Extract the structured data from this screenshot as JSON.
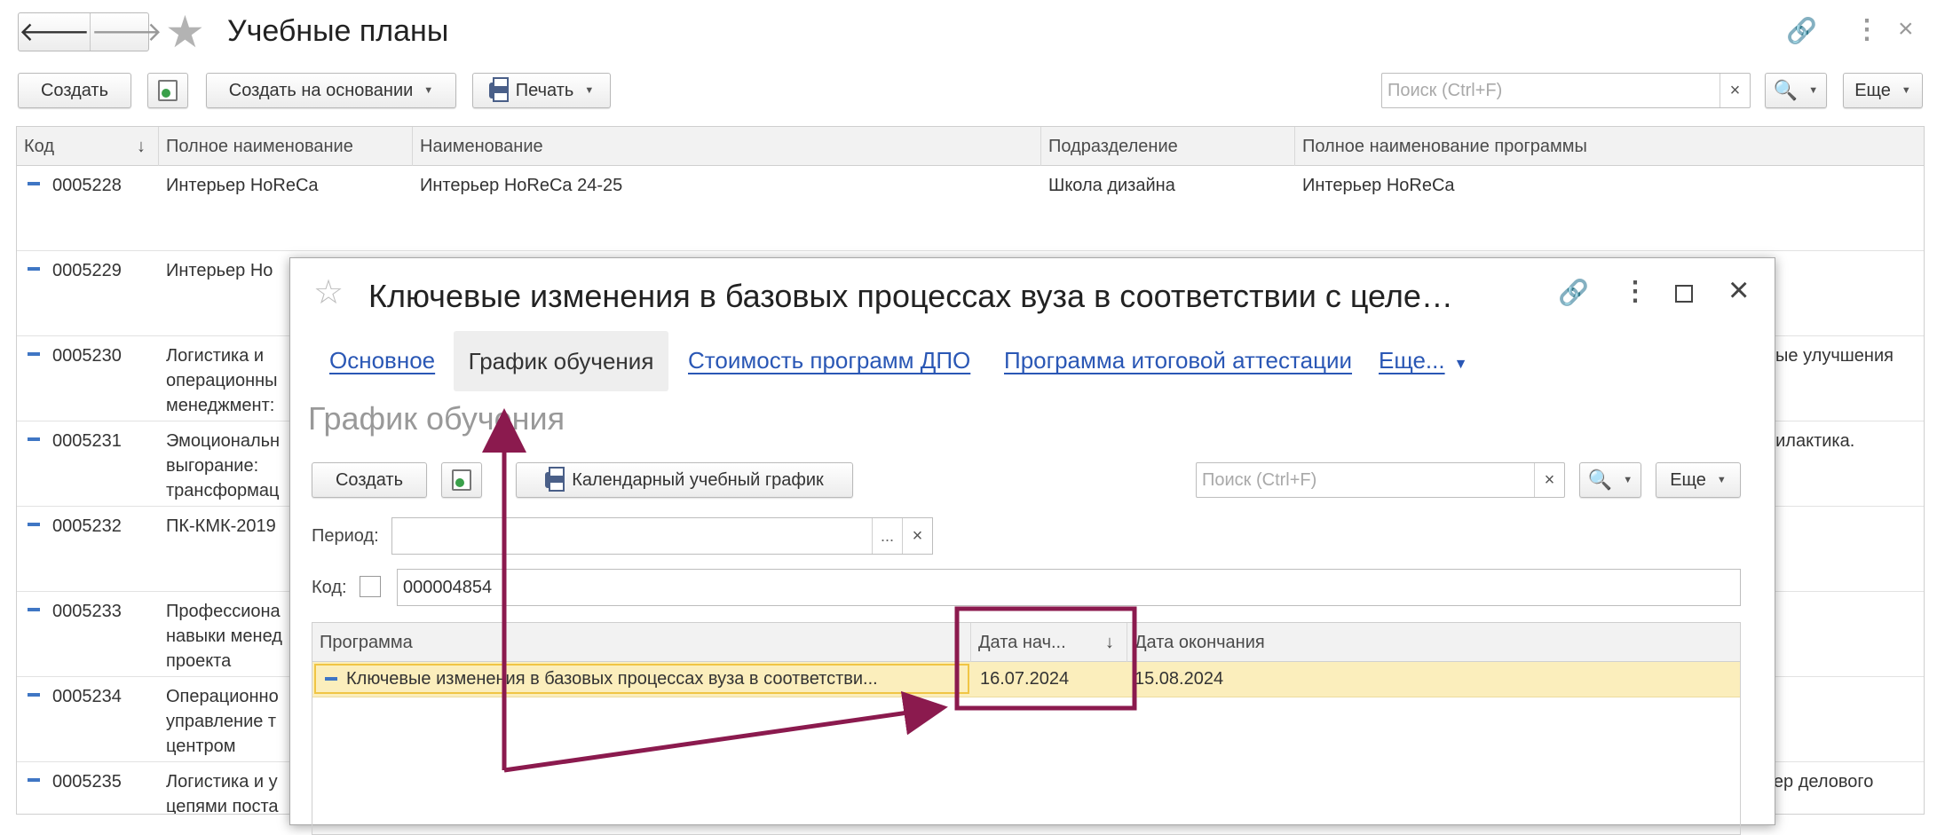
{
  "window": {
    "title": "Учебные планы",
    "back_icon": "arrow-left-icon",
    "forward_icon": "arrow-right-icon",
    "favorite_icon": "star-icon"
  },
  "toolbar": {
    "create_label": "Создать",
    "create_based_label": "Создать на основании",
    "print_label": "Печать",
    "search_placeholder": "Поиск (Ctrl+F)",
    "search_clear": "×",
    "more_label": "Еще"
  },
  "table": {
    "columns": [
      "Код",
      "Полное наименование",
      "Наименование",
      "Подразделение",
      "Полное наименование программы"
    ],
    "rows": [
      {
        "code": "0005228",
        "full_name": "Интерьер HoReCa",
        "name": "Интерьер HoReCa 24-25",
        "division": "Школа дизайна",
        "program": "Интерьер HoReCa"
      },
      {
        "code": "0005229",
        "full_name": "Интерьер Ho",
        "name": "",
        "division": "",
        "program": ""
      },
      {
        "code": "0005230",
        "full_name": "Логистика и\nоперационны\nменеджмент:",
        "name": "",
        "division": "",
        "program": "ные улучшения"
      },
      {
        "code": "0005231",
        "full_name": "Эмоциональн\nвыгорание:\nтрансформац",
        "name": "",
        "division": "",
        "program": "рилактика."
      },
      {
        "code": "0005232",
        "full_name": "ПК-КМК-2019",
        "name": "",
        "division": "",
        "program": ""
      },
      {
        "code": "0005233",
        "full_name": "Профессиона\nнавыки менед\nпроекта",
        "name": "",
        "division": "",
        "program": ""
      },
      {
        "code": "0005234",
        "full_name": "Операционно\nуправление т\nцентром",
        "name": "",
        "division": "",
        "program": ""
      },
      {
        "code": "0005235",
        "full_name": "Логистика и у\nцепями поста",
        "name": "",
        "division": "",
        "program": "тер делового"
      }
    ]
  },
  "dialog": {
    "title": "Ключевые изменения в базовых процессах вуза в соответствии с целе…",
    "tabs": [
      "Основное",
      "График обучения",
      "Стоимость программ ДПО",
      "Программа итоговой аттестации",
      "Еще..."
    ],
    "active_tab": "График обучения",
    "section_title": "График обучения",
    "create_label": "Создать",
    "calendar_label": "Календарный учебный график",
    "search_placeholder": "Поиск (Ctrl+F)",
    "search_clear": "×",
    "more_label": "Еще",
    "period_label": "Период:",
    "period_value": "",
    "period_choose": "...",
    "period_clear": "×",
    "code_label": "Код:",
    "code_value": "000004854",
    "grid": {
      "columns": [
        "Программа",
        "Дата нач...",
        "Дата окончания"
      ],
      "rows": [
        {
          "program": "Ключевые изменения в базовых процессах вуза в соответстви...",
          "start": "16.07.2024",
          "end": "15.08.2024"
        }
      ]
    }
  },
  "annotation": {
    "color": "#8b1a4e"
  },
  "colors": {
    "accent": "#2f6fbf",
    "selection": "#fbeebc",
    "selection_border": "#f0c544"
  }
}
